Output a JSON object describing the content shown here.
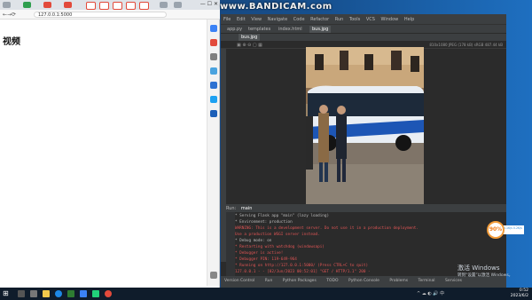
{
  "overlay": {
    "recorder_watermark": "www.BANDICAM.com"
  },
  "browser": {
    "url": "127.0.0.1:5000",
    "page_heading": "视频",
    "window_controls": "— ☐ ✕"
  },
  "ide": {
    "menu": [
      "File",
      "Edit",
      "View",
      "Navigate",
      "Code",
      "Refactor",
      "Run",
      "Tools",
      "VCS",
      "Window",
      "Help"
    ],
    "file_tabs": [
      "app.py",
      "templates",
      "index.html",
      "bus.jpg"
    ],
    "editor_tab": "bus.jpg",
    "image_info": "810x1080 JPEG (178 kB) sRGB 487.44 kB",
    "run_label": "Run:",
    "run_config": "main",
    "console_lines": [
      {
        "text": "* Serving Flask app \"main\" (lazy loading)",
        "color": "#bbbbbb"
      },
      {
        "text": "* Environment: production",
        "color": "#bbbbbb"
      },
      {
        "text": "  WARNING: This is a development server. Do not use it in a production deployment.",
        "color": "#e05555"
      },
      {
        "text": "  Use a production WSGI server instead.",
        "color": "#e05555"
      },
      {
        "text": "* Debug mode: on",
        "color": "#bbbbbb"
      },
      {
        "text": "* Restarting with watchdog (windowsapi)",
        "color": "#e05555"
      },
      {
        "text": "* Debugger is active!",
        "color": "#e05555"
      },
      {
        "text": "* Debugger PIN: 119-649-964",
        "color": "#e05555"
      },
      {
        "text": "* Running on http://127.0.0.1:5000/ (Press CTRL+C to quit)",
        "color": "#e05555"
      },
      {
        "text": "127.0.0.1 - - [02/Jun/2023 00:52:01] \"GET / HTTP/1.1\" 200 -",
        "color": "#e05555"
      }
    ],
    "bottom_tabs": [
      "Version Control",
      "Run",
      "Python Packages",
      "TODO",
      "Python Console",
      "Problems",
      "Terminal",
      "Services"
    ]
  },
  "os": {
    "activate_title": "激活 Windows",
    "activate_sub": "转到“设置”以激活 Windows。",
    "clock_time": "0:52",
    "clock_date": "2023/6/2"
  },
  "speed_badge": {
    "value": "90%",
    "label": "0.1K/s 0.2K/s"
  },
  "colors": {
    "accent": "#f29b38",
    "ide_bg": "#2b2b2b",
    "error_text": "#e05555"
  }
}
